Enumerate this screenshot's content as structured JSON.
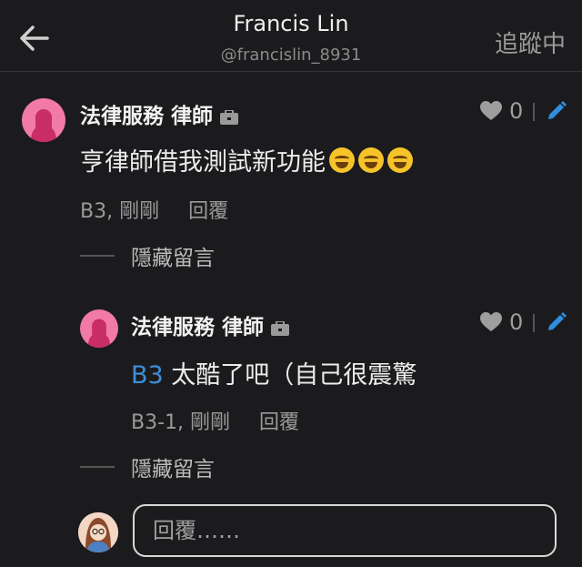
{
  "header": {
    "name": "Francis Lin",
    "handle": "@francislin_8931",
    "follow_label": "追蹤中"
  },
  "comment": {
    "author": "法律服務 律師",
    "likes": "0",
    "text": "亨律師借我測試新功能",
    "emoji_count": 3,
    "meta": "B3, 剛剛",
    "reply_label": "回覆",
    "hide_label": "隱藏留言"
  },
  "reply": {
    "author": "法律服務 律師",
    "likes": "0",
    "mention": "B3",
    "text": "太酷了吧（自己很震驚",
    "meta": "B3-1, 剛剛",
    "reply_label": "回覆",
    "hide_label": "隱藏留言"
  },
  "composer": {
    "placeholder": "回覆……"
  },
  "colors": {
    "background": "#1b1b1d",
    "avatar": "#f27aa6",
    "mention": "#3e8fd8",
    "edit_icon": "#2f8ee0"
  }
}
